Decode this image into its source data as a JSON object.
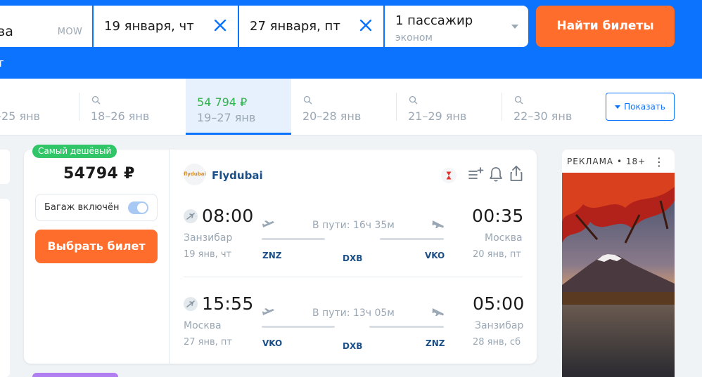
{
  "search": {
    "origin_text": "ва",
    "origin_code": "MOW",
    "depart_date": "19 января, чт",
    "return_date": "27 января, пт",
    "passengers": "1 пассажир",
    "cabin_class": "эконом",
    "find_button": "Найти билеты",
    "sub_link": "т"
  },
  "date_strip": {
    "items": [
      {
        "range": "–25 янв"
      },
      {
        "range": "18–26 янв"
      },
      {
        "price": "54 794 ₽",
        "range": "19–27 янв",
        "active": true
      },
      {
        "range": "20–28 янв"
      },
      {
        "range": "21–29 янв"
      },
      {
        "range": "22–30 янв"
      }
    ],
    "show_button": "Показать"
  },
  "ticket": {
    "badge": "Самый дешёвый",
    "price": "54794 ₽",
    "baggage_label": "Багаж включён",
    "choose_button": "Выбрать билет",
    "airline": "Flydubai",
    "airline_logo_text": "flydubai",
    "segments": [
      {
        "dep_time": "08:00",
        "dep_city": "Занзибар",
        "dep_date": "19 янв, чт",
        "duration": "В пути: 16ч 35м",
        "arr_time": "00:35",
        "arr_city": "Москва",
        "arr_date": "20 янв, пт",
        "from_code": "ZNZ",
        "via_code": "DXB",
        "to_code": "VKO"
      },
      {
        "dep_time": "15:55",
        "dep_city": "Москва",
        "dep_date": "27 янв, пт",
        "duration": "В пути: 13ч 05м",
        "arr_time": "05:00",
        "arr_city": "Занзибар",
        "arr_date": "28 янв, сб",
        "from_code": "VKO",
        "via_code": "DXB",
        "to_code": "ZNZ"
      }
    ]
  },
  "ad": {
    "label": "РЕКЛАМА • 18+",
    "menu": "⋮"
  },
  "colors": {
    "brand_blue": "#0c73fe",
    "accent_orange": "#ff6d2d",
    "badge_green": "#30c567",
    "price_green": "#2eb34a",
    "code_navy": "#1b4f88"
  }
}
